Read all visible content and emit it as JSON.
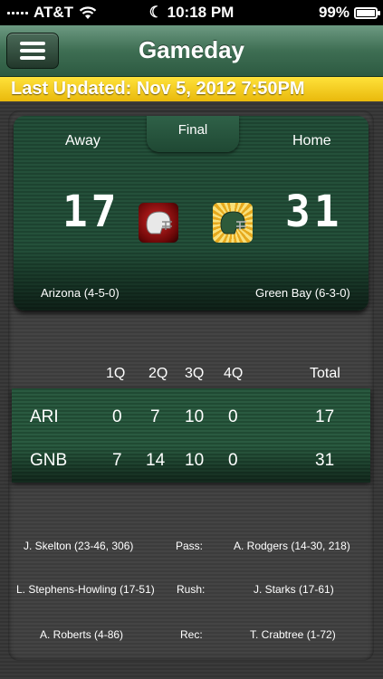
{
  "status_bar": {
    "carrier": "AT&T",
    "time": "10:18 PM",
    "battery": "99%",
    "battery_level": 0.99
  },
  "nav": {
    "title": "Gameday"
  },
  "banner": {
    "last_updated": "Last Updated: Nov 5, 2012 7:50PM"
  },
  "game": {
    "away_label": "Away",
    "home_label": "Home",
    "status": "Final",
    "away_score": "17",
    "home_score": "31",
    "away_team": "Arizona (4-5-0)",
    "home_team": "Green Bay (6-3-0)"
  },
  "box_score": {
    "headers": [
      "1Q",
      "2Q",
      "3Q",
      "4Q",
      "Total"
    ],
    "rows": [
      {
        "team": "ARI",
        "q": [
          "0",
          "7",
          "10",
          "0"
        ],
        "total": "17"
      },
      {
        "team": "GNB",
        "q": [
          "7",
          "14",
          "10",
          "0"
        ],
        "total": "31"
      }
    ]
  },
  "leaders": [
    {
      "away": "J. Skelton (23-46, 306)",
      "category": "Pass:",
      "home": "A. Rodgers (14-30, 218)"
    },
    {
      "away": "L. Stephens-Howling (17-51)",
      "category": "Rush:",
      "home": "J. Starks (17-61)"
    },
    {
      "away": "A. Roberts (4-86)",
      "category": "Rec:",
      "home": "T. Crabtree (1-72)"
    }
  ]
}
